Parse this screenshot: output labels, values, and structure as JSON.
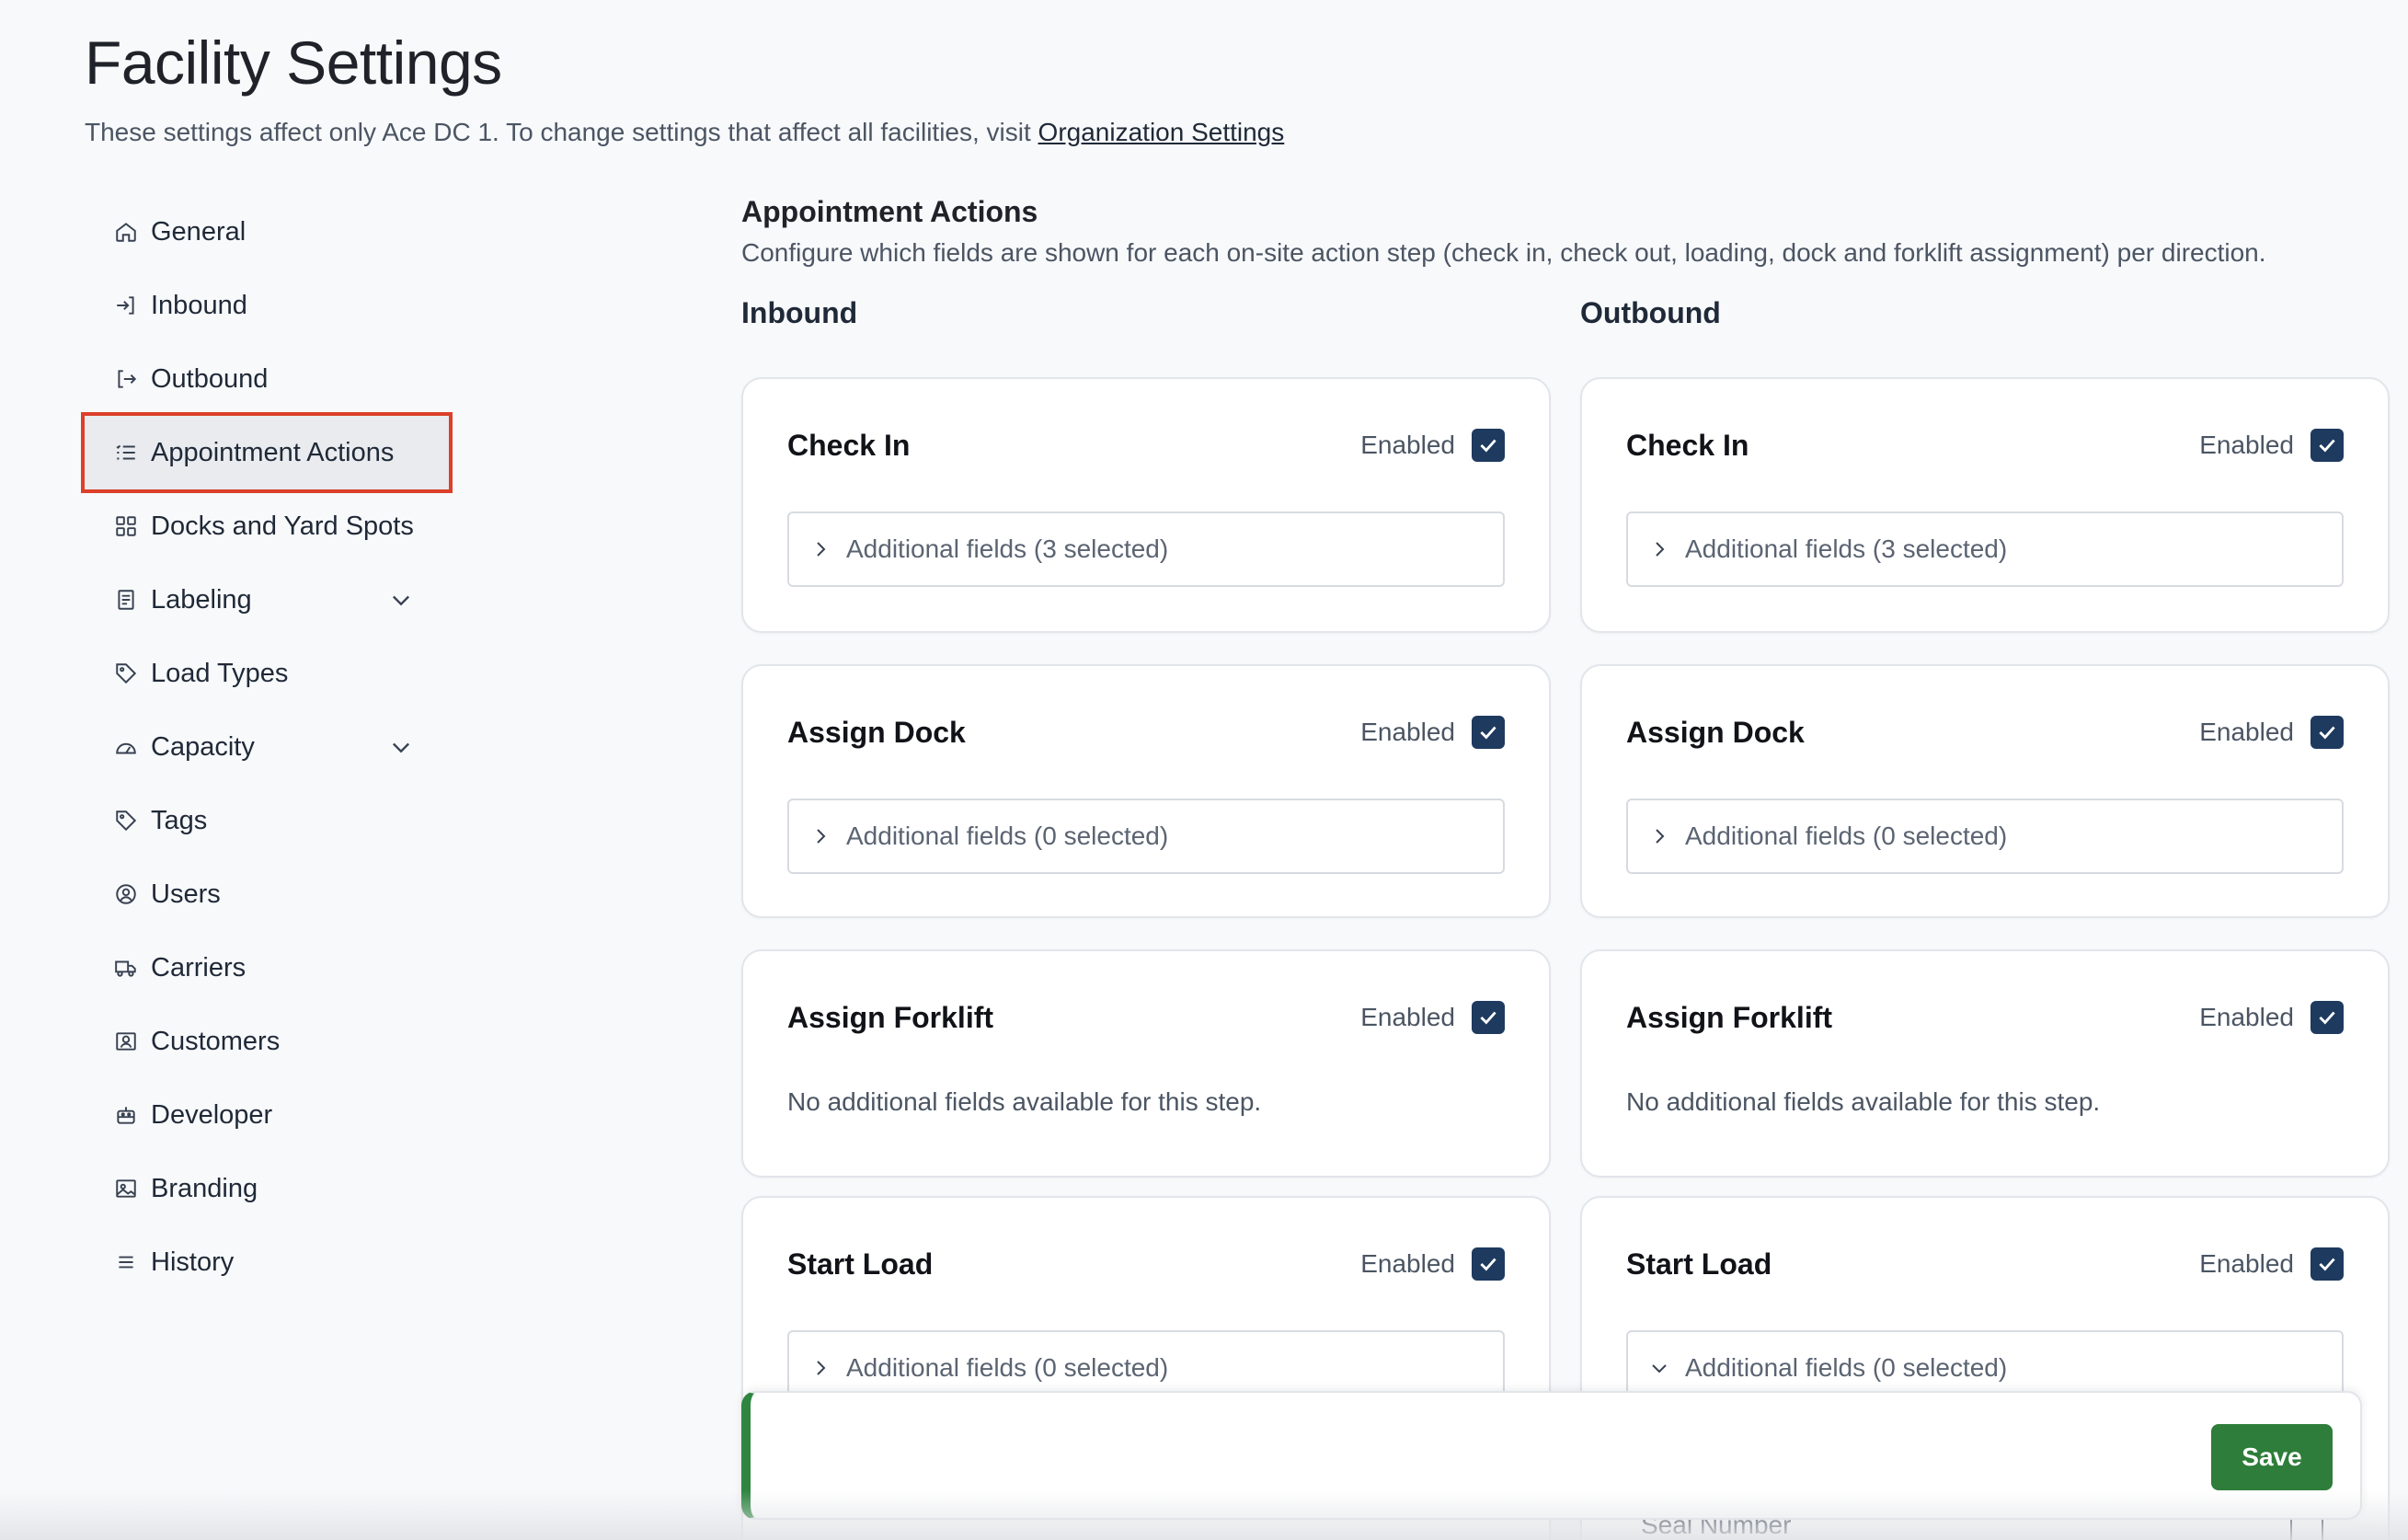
{
  "header": {
    "title": "Facility Settings",
    "subtitle_prefix": "These settings affect only Ace DC 1. To change settings that affect all facilities, visit ",
    "subtitle_link": "Organization Settings"
  },
  "sidebar": {
    "items": [
      {
        "label": "General",
        "icon": "home-icon"
      },
      {
        "label": "Inbound",
        "icon": "inbound-icon"
      },
      {
        "label": "Outbound",
        "icon": "outbound-icon"
      },
      {
        "label": "Appointment Actions",
        "icon": "list-icon",
        "active": true
      },
      {
        "label": "Docks and Yard Spots",
        "icon": "grid-icon"
      },
      {
        "label": "Labeling",
        "icon": "label-icon",
        "expandable": true
      },
      {
        "label": "Load Types",
        "icon": "tag-icon"
      },
      {
        "label": "Capacity",
        "icon": "gauge-icon",
        "expandable": true
      },
      {
        "label": "Tags",
        "icon": "tag-icon"
      },
      {
        "label": "Users",
        "icon": "user-icon"
      },
      {
        "label": "Carriers",
        "icon": "truck-icon"
      },
      {
        "label": "Customers",
        "icon": "contact-icon"
      },
      {
        "label": "Developer",
        "icon": "robot-icon"
      },
      {
        "label": "Branding",
        "icon": "image-icon"
      },
      {
        "label": "History",
        "icon": "menu-icon"
      }
    ]
  },
  "main": {
    "title": "Appointment Actions",
    "description": "Configure which fields are shown for each on-site action step (check in, check out, loading, dock and forklift assignment) per direction.",
    "inbound_label": "Inbound",
    "outbound_label": "Outbound",
    "enabled_label": "Enabled",
    "inbound": [
      {
        "title": "Check In",
        "fields": "Additional fields (3 selected)"
      },
      {
        "title": "Assign Dock",
        "fields": "Additional fields (0 selected)"
      },
      {
        "title": "Assign Forklift",
        "note": "No additional fields available for this step."
      },
      {
        "title": "Start Load",
        "fields": "Additional fields (0 selected)"
      }
    ],
    "outbound": [
      {
        "title": "Check In",
        "fields": "Additional fields (3 selected)"
      },
      {
        "title": "Assign Dock",
        "fields": "Additional fields (0 selected)"
      },
      {
        "title": "Assign Forklift",
        "note": "No additional fields available for this step."
      },
      {
        "title": "Start Load",
        "fields": "Additional fields (0 selected)",
        "expanded": true
      }
    ],
    "seal_label": "Seal Number"
  },
  "savebar": {
    "save_label": "Save"
  },
  "colors": {
    "accent": "#1e3a5f",
    "save": "#2e7d3a",
    "active_outline": "#dc3f2a"
  }
}
